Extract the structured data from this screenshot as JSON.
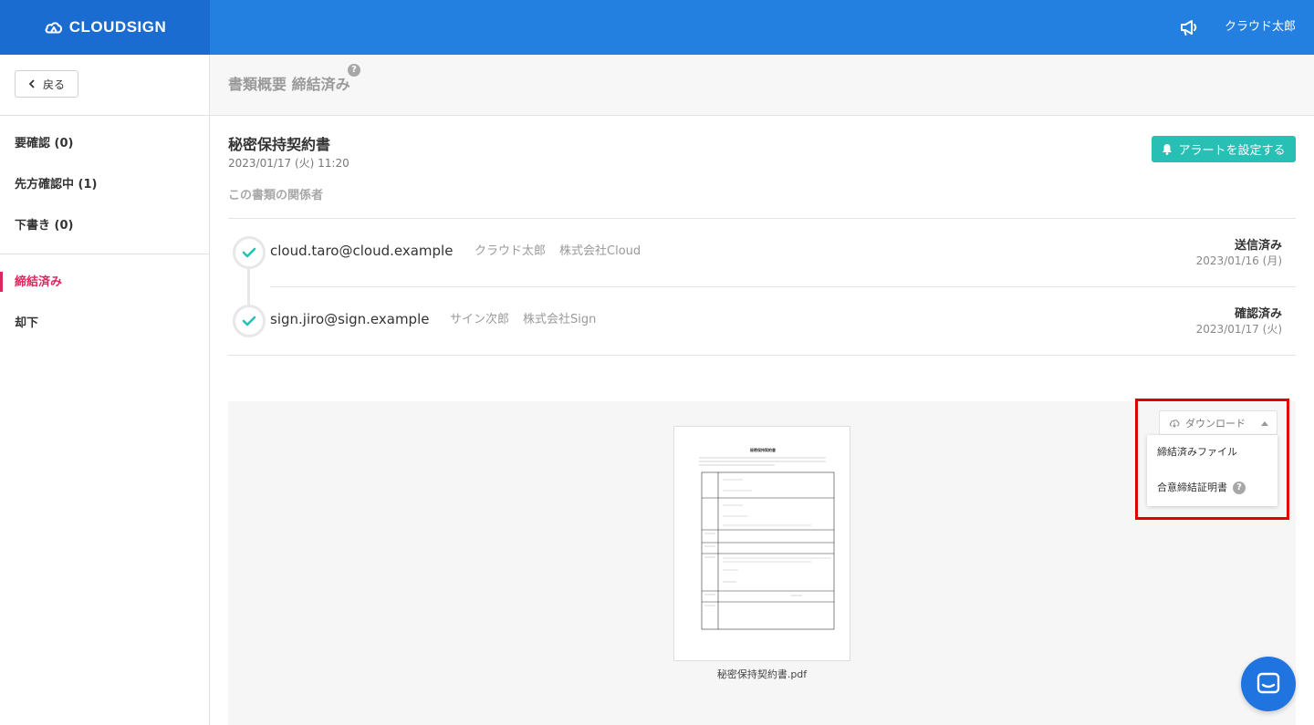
{
  "header": {
    "brand": "CLOUDSIGN",
    "user_name": "クラウド太郎"
  },
  "sidebar": {
    "back_label": "戻る",
    "items": [
      {
        "label": "要確認 (0)"
      },
      {
        "label": "先方確認中 (1)"
      },
      {
        "label": "下書き (0)"
      },
      {
        "label": "締結済み",
        "active": true
      },
      {
        "label": "却下"
      }
    ]
  },
  "title_bar": {
    "title": "書類概要 締結済み",
    "help": "?"
  },
  "document": {
    "title": "秘密保持契約書",
    "date": "2023/01/17 (火) 11:20",
    "alert_button": "アラートを設定する",
    "parties_label": "この書類の関係者",
    "parties": [
      {
        "email": "cloud.taro@cloud.example",
        "name": "クラウド太郎",
        "company": "株式会社Cloud",
        "status": "送信済み",
        "status_date": "2023/01/16 (月)"
      },
      {
        "email": "sign.jiro@sign.example",
        "name": "サイン次郎",
        "company": "株式会社Sign",
        "status": "確認済み",
        "status_date": "2023/01/17 (火)"
      }
    ]
  },
  "preview": {
    "file_name": "秘密保持契約書.pdf",
    "thumbnail_heading": "秘密保持契約書"
  },
  "download": {
    "label": "ダウンロード",
    "menu": [
      {
        "label": "締結済みファイル"
      },
      {
        "label": "合意締結証明書",
        "help": "?"
      }
    ]
  },
  "colors": {
    "header": "#2380e0",
    "brand_bg": "#1a6cd0",
    "accent_teal": "#28c0b5",
    "active_nav": "#e0245e",
    "highlight": "#e00000",
    "chat": "#1f74e0"
  }
}
